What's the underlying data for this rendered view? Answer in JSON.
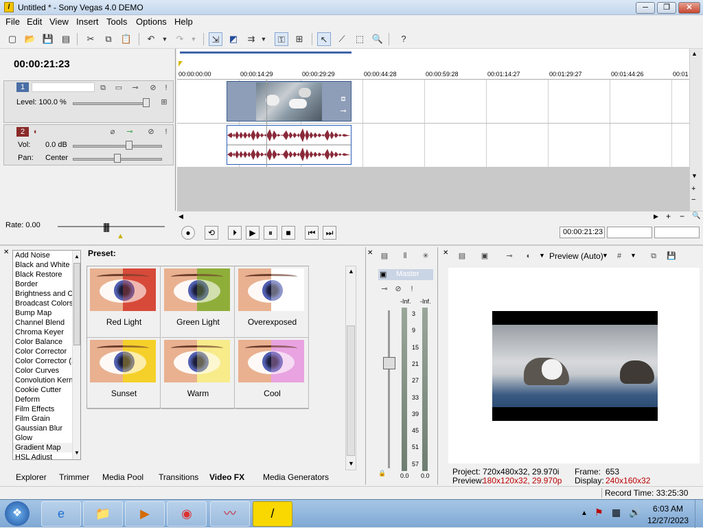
{
  "window": {
    "title": "Untitled * - Sony Vegas 4.0 DEMO",
    "min": "─",
    "max": "❐",
    "close": "✕"
  },
  "menu": [
    "File",
    "Edit",
    "View",
    "Insert",
    "Tools",
    "Options",
    "Help"
  ],
  "timecode": "00:00:21:23",
  "track1": {
    "number": "1",
    "level_label": "Level: 100.0 %",
    "level": 1.0
  },
  "track2": {
    "number": "2",
    "vol_label": "Vol:",
    "vol_value": "0.0 dB",
    "pan_label": "Pan:",
    "pan_value": "Center"
  },
  "ruler": [
    "00:00:00:00",
    "00:00:14:29",
    "00:00:29:29",
    "00:00:44:28",
    "00:00:59:28",
    "00:01:14:27",
    "00:01:29:27",
    "00:01:44:26",
    "00:01"
  ],
  "rate_label": "Rate: 0.00",
  "transport_time": "00:00:21:23",
  "fx_list": [
    "Add Noise",
    "Black and White",
    "Black Restore",
    "Border",
    "Brightness and C",
    "Broadcast Colors",
    "Bump Map",
    "Channel Blend",
    "Chroma Keyer",
    "Color Balance",
    "Color Corrector",
    "Color Corrector (S",
    "Color Curves",
    "Convolution Kern",
    "Cookie Cutter",
    "Deform",
    "Film Effects",
    "Film Grain",
    "Gaussian Blur",
    "Glow",
    "Gradient Map",
    "HSL Adjust"
  ],
  "preset_label": "Preset:",
  "presets": [
    {
      "name": "Red  Light",
      "tint": "#d84a3a"
    },
    {
      "name": "Green  Light",
      "tint": "#8fae3a"
    },
    {
      "name": "Overexposed",
      "tint": "#ffffff"
    },
    {
      "name": "Sunset",
      "tint": "#f5d02a"
    },
    {
      "name": "Warm",
      "tint": "#f7ec8a"
    },
    {
      "name": "Cool",
      "tint": "#e9a3e0"
    }
  ],
  "tabs": [
    "Explorer",
    "Trimmer",
    "Media Pool",
    "Transitions",
    "Video FX",
    "Media Generators"
  ],
  "active_tab": "Video FX",
  "mixer": {
    "label": "Master",
    "peak_l": "-Inf.",
    "peak_r": "-Inf.",
    "scale": [
      "3",
      "9",
      "15",
      "21",
      "27",
      "33",
      "39",
      "45",
      "51",
      "57"
    ],
    "bottom_l": "0.0",
    "bottom_r": "0.0"
  },
  "preview": {
    "mode": "Preview (Auto)",
    "project_label": "Project:",
    "project_value": "720x480x32, 29.970i",
    "preview_label": "Preview:",
    "preview_value": "180x120x32, 29.970p",
    "frame_label": "Frame:",
    "frame_value": "653",
    "display_label": "Display:",
    "display_value": "240x160x32"
  },
  "status": {
    "record_time": "Record Time: 33:25:30"
  },
  "taskbar": {
    "time": "6:03 AM",
    "date": "12/27/2023"
  }
}
